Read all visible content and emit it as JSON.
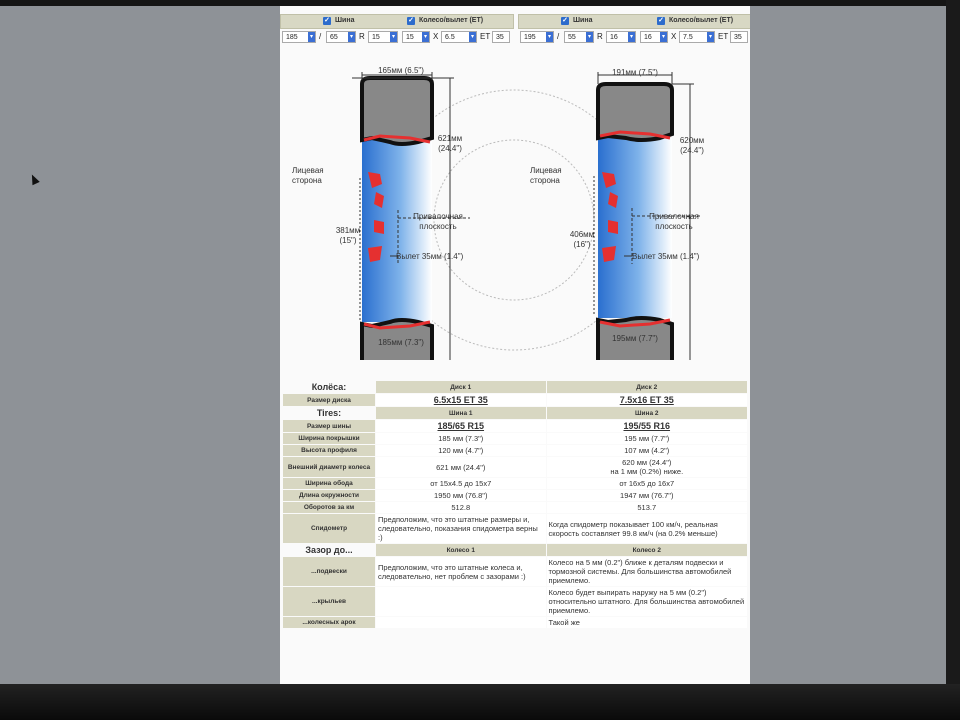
{
  "controls": {
    "left": {
      "tire_label": "Шина",
      "wheel_label": "Колесо/вылет (ET)",
      "tire_width": "185",
      "tire_profile": "65",
      "r_symbol": "R",
      "tire_rim": "15",
      "wheel_diam": "15",
      "x_symbol": "X",
      "wheel_width": "6.5",
      "et_label": "ET",
      "et_value": "35"
    },
    "right": {
      "tire_label": "Шина",
      "wheel_label": "Колесо/вылет (ET)",
      "tire_width": "195",
      "tire_profile": "55",
      "r_symbol": "R",
      "tire_rim": "16",
      "wheel_diam": "16",
      "x_symbol": "X",
      "wheel_width": "7.5",
      "et_label": "ET",
      "et_value": "35"
    },
    "slash": "/"
  },
  "diagram1": {
    "top_width": "165мм (6.5\")",
    "outer_diam_1": "621мм",
    "outer_diam_2": "(24.4\")",
    "face_1": "Лицевая",
    "face_2": "сторона",
    "mount_1": "Привалочная",
    "mount_2": "плоскость",
    "rim_diam_1": "381мм",
    "rim_diam_2": "(15\")",
    "offset": "Вылет 35мм (1.4\")",
    "bottom_width": "185мм (7.3\")"
  },
  "diagram2": {
    "top_width": "191мм (7.5\")",
    "outer_diam_1": "620мм",
    "outer_diam_2": "(24.4\")",
    "face_1": "Лицевая",
    "face_2": "сторона",
    "mount_1": "Привалочная",
    "mount_2": "плоскость",
    "rim_diam_1": "406мм",
    "rim_diam_2": "(16\")",
    "offset": "Вылет 35мм (1.4\")",
    "bottom_width": "195мм (7.7\")"
  },
  "table": {
    "wheels_header": "Колёса:",
    "disk1": "Диск 1",
    "disk2": "Диск 2",
    "disk_size_label": "Размер диска",
    "disk_size_1": "6.5x15 ET 35",
    "disk_size_2": "7.5x16 ET 35",
    "tires_header": "Tires:",
    "tire1": "Шина 1",
    "tire2": "Шина 2",
    "rows": [
      {
        "label": "Размер шины",
        "v1": "185/65 R15",
        "v2": "195/55 R16"
      },
      {
        "label": "Ширина покрышки",
        "v1": "185 мм (7.3\")",
        "v2": "195 мм (7.7\")"
      },
      {
        "label": "Высота профиля",
        "v1": "120 мм (4.7\")",
        "v2": "107 мм (4.2\")"
      },
      {
        "label": "Внешний диаметр колеса",
        "v1": "621 мм (24.4\")",
        "v2": "620 мм (24.4\")",
        "v2b": "на 1 мм (0.2%) ниже."
      },
      {
        "label": "Ширина обода",
        "v1": "от 15x4.5 до 15x7",
        "v2": "от 16x5 до 16x7"
      },
      {
        "label": "Длина окружности",
        "v1": "1950 мм (76.8\")",
        "v2": "1947 мм (76.7\")"
      },
      {
        "label": "Оборотов за км",
        "v1": "512.8",
        "v2": "513.7"
      },
      {
        "label": "Спидометр",
        "v1": "Предположим, что это штатные размеры и, следовательно, показания спидометра верны :)",
        "v2": "Когда спидометр показывает 100 км/ч, реальная скорость составляет 99.8 км/ч (на 0.2% меньше)"
      }
    ],
    "clearance_header": "Зазор до...",
    "wheel1": "Колесо 1",
    "wheel2": "Колесо 2",
    "clearance_rows": [
      {
        "label": "...подвески",
        "v1": "Предположим, что это штатные колеса и, следовательно, нет проблем с зазорами :)",
        "v2": "Колесо на 5 мм (0.2\") ближе к деталям подвески и тормозной системы. Для большинства автомобилей приемлемо."
      },
      {
        "label": "...крыльев",
        "v1": "",
        "v2": "Колесо будет выпирать наружу на 5 мм (0.2\") относительно штатного. Для большинства автомобилей приемлемо."
      },
      {
        "label": "...колесных арок",
        "v1": "",
        "v2": "Такой же"
      }
    ]
  },
  "colors": {
    "accent_blue": "#3b6fd4",
    "header_beige": "#d8d7c2",
    "tire_red": "#e53030",
    "rim_blue": "#3d8bd8"
  }
}
